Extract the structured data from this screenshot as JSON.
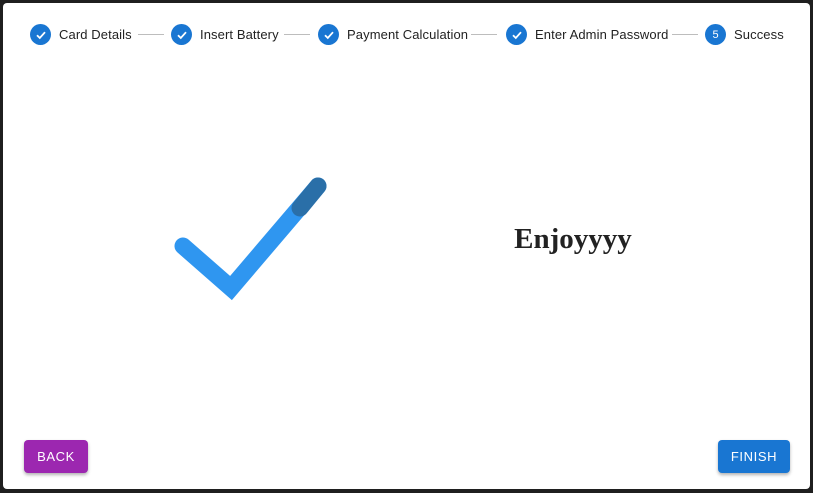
{
  "stepper": {
    "steps": [
      {
        "label": "Card Details",
        "status": "completed",
        "icon": "check-icon"
      },
      {
        "label": "Insert Battery",
        "status": "completed",
        "icon": "check-icon"
      },
      {
        "label": "Payment Calculation",
        "status": "completed",
        "icon": "check-icon"
      },
      {
        "label": "Enter Admin Password",
        "status": "completed",
        "icon": "check-icon"
      },
      {
        "label": "Success",
        "status": "active",
        "number": "5"
      }
    ],
    "accent_color": "#1976d2"
  },
  "success": {
    "icon": "success-check-icon",
    "message": "Enjoyyyy",
    "check_color": "#2f96f0"
  },
  "actions": {
    "back_label": "BACK",
    "back_color": "#9c27b0",
    "finish_label": "FINISH",
    "finish_color": "#1976d2"
  }
}
